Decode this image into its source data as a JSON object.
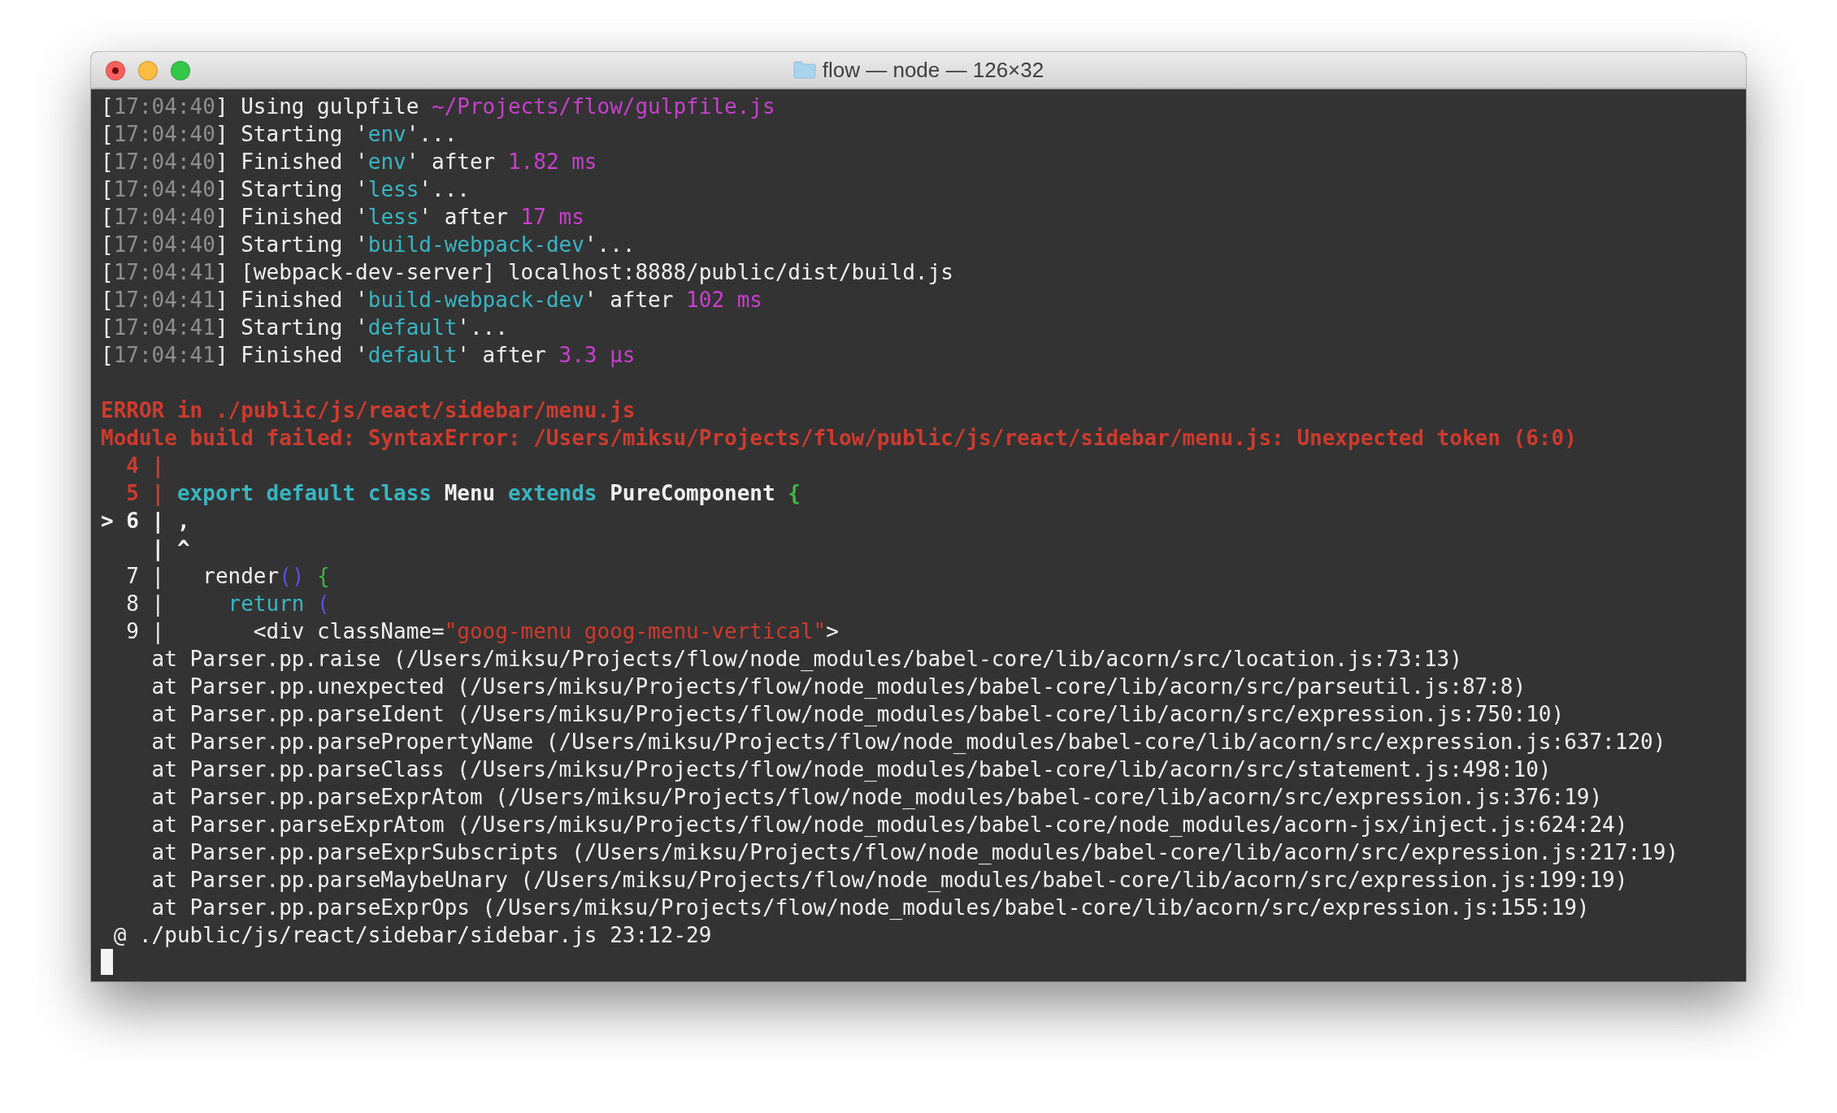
{
  "window": {
    "title": "flow — node — 126×32"
  },
  "build_log": [
    {
      "segments": [
        {
          "text": "[",
          "color": "#f0f0f0",
          "bold": false
        },
        {
          "text": "17:04:40",
          "color": "#8e8e8e",
          "bold": false
        },
        {
          "text": "] Using gulpfile ",
          "color": "#f0f0f0",
          "bold": false
        },
        {
          "text": "~/Projects/flow/gulpfile.js",
          "color": "#c93fcd",
          "bold": false
        }
      ]
    },
    {
      "segments": [
        {
          "text": "[",
          "color": "#f0f0f0",
          "bold": false
        },
        {
          "text": "17:04:40",
          "color": "#8e8e8e",
          "bold": false
        },
        {
          "text": "] Starting '",
          "color": "#f0f0f0",
          "bold": false
        },
        {
          "text": "env",
          "color": "#38b5c2",
          "bold": false
        },
        {
          "text": "'...",
          "color": "#f0f0f0",
          "bold": false
        }
      ]
    },
    {
      "segments": [
        {
          "text": "[",
          "color": "#f0f0f0",
          "bold": false
        },
        {
          "text": "17:04:40",
          "color": "#8e8e8e",
          "bold": false
        },
        {
          "text": "] Finished '",
          "color": "#f0f0f0",
          "bold": false
        },
        {
          "text": "env",
          "color": "#38b5c2",
          "bold": false
        },
        {
          "text": "' after ",
          "color": "#f0f0f0",
          "bold": false
        },
        {
          "text": "1.82 ms",
          "color": "#c93fcd",
          "bold": false
        }
      ]
    },
    {
      "segments": [
        {
          "text": "[",
          "color": "#f0f0f0",
          "bold": false
        },
        {
          "text": "17:04:40",
          "color": "#8e8e8e",
          "bold": false
        },
        {
          "text": "] Starting '",
          "color": "#f0f0f0",
          "bold": false
        },
        {
          "text": "less",
          "color": "#38b5c2",
          "bold": false
        },
        {
          "text": "'...",
          "color": "#f0f0f0",
          "bold": false
        }
      ]
    },
    {
      "segments": [
        {
          "text": "[",
          "color": "#f0f0f0",
          "bold": false
        },
        {
          "text": "17:04:40",
          "color": "#8e8e8e",
          "bold": false
        },
        {
          "text": "] Finished '",
          "color": "#f0f0f0",
          "bold": false
        },
        {
          "text": "less",
          "color": "#38b5c2",
          "bold": false
        },
        {
          "text": "' after ",
          "color": "#f0f0f0",
          "bold": false
        },
        {
          "text": "17 ms",
          "color": "#c93fcd",
          "bold": false
        }
      ]
    },
    {
      "segments": [
        {
          "text": "[",
          "color": "#f0f0f0",
          "bold": false
        },
        {
          "text": "17:04:40",
          "color": "#8e8e8e",
          "bold": false
        },
        {
          "text": "] Starting '",
          "color": "#f0f0f0",
          "bold": false
        },
        {
          "text": "build-webpack-dev",
          "color": "#38b5c2",
          "bold": false
        },
        {
          "text": "'...",
          "color": "#f0f0f0",
          "bold": false
        }
      ]
    },
    {
      "segments": [
        {
          "text": "[",
          "color": "#f0f0f0",
          "bold": false
        },
        {
          "text": "17:04:41",
          "color": "#8e8e8e",
          "bold": false
        },
        {
          "text": "] [webpack-dev-server] localhost:8888/public/dist/build.js",
          "color": "#f0f0f0",
          "bold": false
        }
      ]
    },
    {
      "segments": [
        {
          "text": "[",
          "color": "#f0f0f0",
          "bold": false
        },
        {
          "text": "17:04:41",
          "color": "#8e8e8e",
          "bold": false
        },
        {
          "text": "] Finished '",
          "color": "#f0f0f0",
          "bold": false
        },
        {
          "text": "build-webpack-dev",
          "color": "#38b5c2",
          "bold": false
        },
        {
          "text": "' after ",
          "color": "#f0f0f0",
          "bold": false
        },
        {
          "text": "102 ms",
          "color": "#c93fcd",
          "bold": false
        }
      ]
    },
    {
      "segments": [
        {
          "text": "[",
          "color": "#f0f0f0",
          "bold": false
        },
        {
          "text": "17:04:41",
          "color": "#8e8e8e",
          "bold": false
        },
        {
          "text": "] Starting '",
          "color": "#f0f0f0",
          "bold": false
        },
        {
          "text": "default",
          "color": "#38b5c2",
          "bold": false
        },
        {
          "text": "'...",
          "color": "#f0f0f0",
          "bold": false
        }
      ]
    },
    {
      "segments": [
        {
          "text": "[",
          "color": "#f0f0f0",
          "bold": false
        },
        {
          "text": "17:04:41",
          "color": "#8e8e8e",
          "bold": false
        },
        {
          "text": "] Finished '",
          "color": "#f0f0f0",
          "bold": false
        },
        {
          "text": "default",
          "color": "#38b5c2",
          "bold": false
        },
        {
          "text": "' after ",
          "color": "#f0f0f0",
          "bold": false
        },
        {
          "text": "3.3 μs",
          "color": "#c93fcd",
          "bold": false
        }
      ]
    }
  ],
  "error_output": [
    {
      "segments": [
        {
          "text": "ERROR in ./public/js/react/sidebar/menu.js",
          "color": "#cc3b2e",
          "bold": true
        }
      ]
    },
    {
      "segments": [
        {
          "text": "Module build failed: SyntaxError: /Users/miksu/Projects/flow/public/js/react/sidebar/menu.js: Unexpected token (6:0)",
          "color": "#cc3b2e",
          "bold": true
        }
      ]
    },
    {
      "segments": [
        {
          "text": "  4 |",
          "color": "#cc3b2e",
          "bold": true
        }
      ]
    },
    {
      "segments": [
        {
          "text": "  5 | ",
          "color": "#cc3b2e",
          "bold": true
        },
        {
          "text": "export default class",
          "color": "#38b5c2",
          "bold": true
        },
        {
          "text": " Menu ",
          "color": "#f0f0f0",
          "bold": true
        },
        {
          "text": "extends",
          "color": "#38b5c2",
          "bold": true
        },
        {
          "text": " PureComponent ",
          "color": "#f0f0f0",
          "bold": true
        },
        {
          "text": "{",
          "color": "#3fb93f",
          "bold": true
        }
      ]
    },
    {
      "segments": [
        {
          "text": "> 6 | ,",
          "color": "#f0f0f0",
          "bold": true
        }
      ]
    },
    {
      "segments": [
        {
          "text": "    | ^",
          "color": "#f0f0f0",
          "bold": true
        }
      ]
    },
    {
      "segments": [
        {
          "text": "  7 |   render",
          "color": "#f0f0f0",
          "bold": false
        },
        {
          "text": "()",
          "color": "#5c4fe0",
          "bold": false
        },
        {
          "text": " {",
          "color": "#3fb93f",
          "bold": false
        }
      ]
    },
    {
      "segments": [
        {
          "text": "  8 |     ",
          "color": "#f0f0f0",
          "bold": false
        },
        {
          "text": "return",
          "color": "#38b5c2",
          "bold": false
        },
        {
          "text": " (",
          "color": "#5c4fe0",
          "bold": false
        }
      ]
    },
    {
      "segments": [
        {
          "text": "  9 |       <div className=",
          "color": "#f0f0f0",
          "bold": false
        },
        {
          "text": "\"goog-menu goog-menu-vertical\"",
          "color": "#cc3b2e",
          "bold": false
        },
        {
          "text": ">",
          "color": "#f0f0f0",
          "bold": false
        }
      ]
    },
    {
      "segments": [
        {
          "text": "    at Parser.pp.raise (/Users/miksu/Projects/flow/node_modules/babel-core/lib/acorn/src/location.js:73:13)",
          "color": "#f0f0f0",
          "bold": false
        }
      ]
    },
    {
      "segments": [
        {
          "text": "    at Parser.pp.unexpected (/Users/miksu/Projects/flow/node_modules/babel-core/lib/acorn/src/parseutil.js:87:8)",
          "color": "#f0f0f0",
          "bold": false
        }
      ]
    },
    {
      "segments": [
        {
          "text": "    at Parser.pp.parseIdent (/Users/miksu/Projects/flow/node_modules/babel-core/lib/acorn/src/expression.js:750:10)",
          "color": "#f0f0f0",
          "bold": false
        }
      ]
    },
    {
      "segments": [
        {
          "text": "    at Parser.pp.parsePropertyName (/Users/miksu/Projects/flow/node_modules/babel-core/lib/acorn/src/expression.js:637:120)",
          "color": "#f0f0f0",
          "bold": false
        }
      ]
    },
    {
      "segments": [
        {
          "text": "    at Parser.pp.parseClass (/Users/miksu/Projects/flow/node_modules/babel-core/lib/acorn/src/statement.js:498:10)",
          "color": "#f0f0f0",
          "bold": false
        }
      ]
    },
    {
      "segments": [
        {
          "text": "    at Parser.pp.parseExprAtom (/Users/miksu/Projects/flow/node_modules/babel-core/lib/acorn/src/expression.js:376:19)",
          "color": "#f0f0f0",
          "bold": false
        }
      ]
    },
    {
      "segments": [
        {
          "text": "    at Parser.parseExprAtom (/Users/miksu/Projects/flow/node_modules/babel-core/node_modules/acorn-jsx/inject.js:624:24)",
          "color": "#f0f0f0",
          "bold": false
        }
      ]
    },
    {
      "segments": [
        {
          "text": "    at Parser.pp.parseExprSubscripts (/Users/miksu/Projects/flow/node_modules/babel-core/lib/acorn/src/expression.js:217:19)",
          "color": "#f0f0f0",
          "bold": false
        }
      ]
    },
    {
      "segments": [
        {
          "text": "    at Parser.pp.parseMaybeUnary (/Users/miksu/Projects/flow/node_modules/babel-core/lib/acorn/src/expression.js:199:19)",
          "color": "#f0f0f0",
          "bold": false
        }
      ]
    },
    {
      "segments": [
        {
          "text": "    at Parser.pp.parseExprOps (/Users/miksu/Projects/flow/node_modules/babel-core/lib/acorn/src/expression.js:155:19)",
          "color": "#f0f0f0",
          "bold": false
        }
      ]
    },
    {
      "segments": [
        {
          "text": " @ ./public/js/react/sidebar/sidebar.js 23:12-29",
          "color": "#f0f0f0",
          "bold": false
        }
      ]
    }
  ]
}
